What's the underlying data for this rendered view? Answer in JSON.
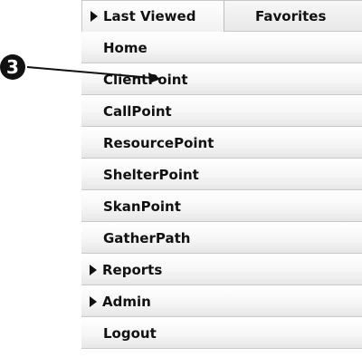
{
  "callout": {
    "number": "3"
  },
  "tabs": [
    {
      "label": "Last Viewed"
    },
    {
      "label": "Favorites"
    }
  ],
  "menu": {
    "items": [
      {
        "label": "Home"
      },
      {
        "label": "ClientPoint"
      },
      {
        "label": "CallPoint"
      },
      {
        "label": "ResourcePoint"
      },
      {
        "label": "ShelterPoint"
      },
      {
        "label": "SkanPoint"
      },
      {
        "label": "GatherPath"
      },
      {
        "label": "Reports"
      },
      {
        "label": "Admin"
      },
      {
        "label": "Logout"
      }
    ]
  },
  "icons": {
    "tab_expand": "caret-right-icon",
    "submenu_expand": "caret-right-icon",
    "callout_arrow": "arrow-icon"
  },
  "colors": {
    "text": "#111111",
    "row_border": "#c9c9c9",
    "callout": "#111111"
  }
}
